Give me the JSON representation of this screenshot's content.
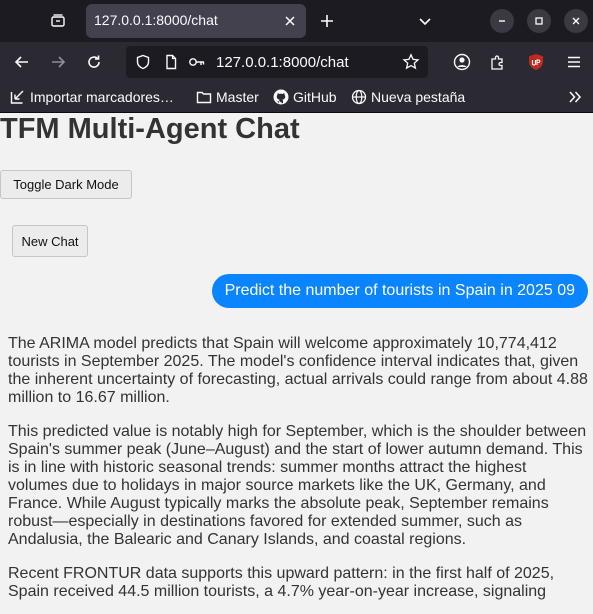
{
  "browser": {
    "tab_title": "127.0.0.1:8000/chat",
    "url": "127.0.0.1:8000/chat",
    "bookmarks": [
      {
        "label": "Importar marcadores…",
        "icon": "import-icon"
      },
      {
        "label": "Master",
        "icon": "folder-icon"
      },
      {
        "label": "GitHub",
        "icon": "github-icon"
      },
      {
        "label": "Nueva pestaña",
        "icon": "globe-icon"
      }
    ]
  },
  "page": {
    "title": "TFM Multi-Agent Chat",
    "toggle_dark_label": "Toggle Dark Mode",
    "new_chat_label": "New Chat"
  },
  "chat": {
    "user_message": "Predict the number of tourists in Spain in 2025 09",
    "assistant_paragraphs": [
      "The ARIMA model predicts that Spain will welcome approximately 10,774,412 tourists in September 2025. The model's confidence interval indicates that, given the inherent uncertainty of forecasting, actual arrivals could range from about 4.88 million to 16.67 million.",
      "This predicted value is notably high for September, which is the shoulder between Spain's summer peak (June–August) and the start of lower autumn demand. This is in line with historic seasonal trends: summer months attract the highest volumes due to holidays in major source markets like the UK, Germany, and France. While August typically marks the absolute peak, September remains robust—especially in destinations favored for extended summer, such as Andalusia, the Balearic and Canary Islands, and coastal regions.",
      "Recent FRONTUR data supports this upward pattern: in the first half of 2025, Spain received 44.5 million tourists, a 4.7% year-on-year increase, signaling"
    ]
  },
  "colors": {
    "user_bubble": "#0a84ff",
    "page_bg": "#f2f2f2",
    "ublock_badge": "#c0291f"
  }
}
